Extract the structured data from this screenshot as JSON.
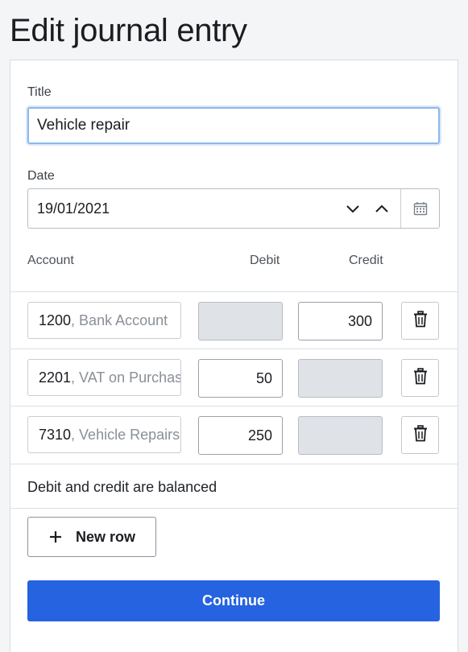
{
  "page": {
    "title": "Edit journal entry"
  },
  "form": {
    "title_label": "Title",
    "title_value": "Vehicle repair",
    "date_label": "Date",
    "date_value": "19/01/2021"
  },
  "table": {
    "headers": {
      "account": "Account",
      "debit": "Debit",
      "credit": "Credit"
    },
    "rows": [
      {
        "account_number": "1200",
        "account_name": ", Bank Account",
        "debit": "",
        "credit": "300",
        "debit_disabled": true,
        "credit_disabled": false
      },
      {
        "account_number": "2201",
        "account_name": ", VAT on Purchases",
        "debit": "50",
        "credit": "",
        "debit_disabled": false,
        "credit_disabled": true
      },
      {
        "account_number": "7310",
        "account_name": ", Vehicle Repairs",
        "debit": "250",
        "credit": "",
        "debit_disabled": false,
        "credit_disabled": true
      }
    ]
  },
  "status": {
    "balance_message": "Debit and credit are balanced"
  },
  "actions": {
    "new_row_label": "New row",
    "continue_label": "Continue"
  },
  "icons": {
    "decrement": "chevron-down-icon",
    "increment": "chevron-up-icon",
    "calendar": "calendar-icon",
    "delete": "trash-icon",
    "add": "plus-icon"
  },
  "colors": {
    "primary": "#2563e0",
    "focus_border": "#8cb8ea",
    "disabled_fill": "#dfe2e6"
  }
}
